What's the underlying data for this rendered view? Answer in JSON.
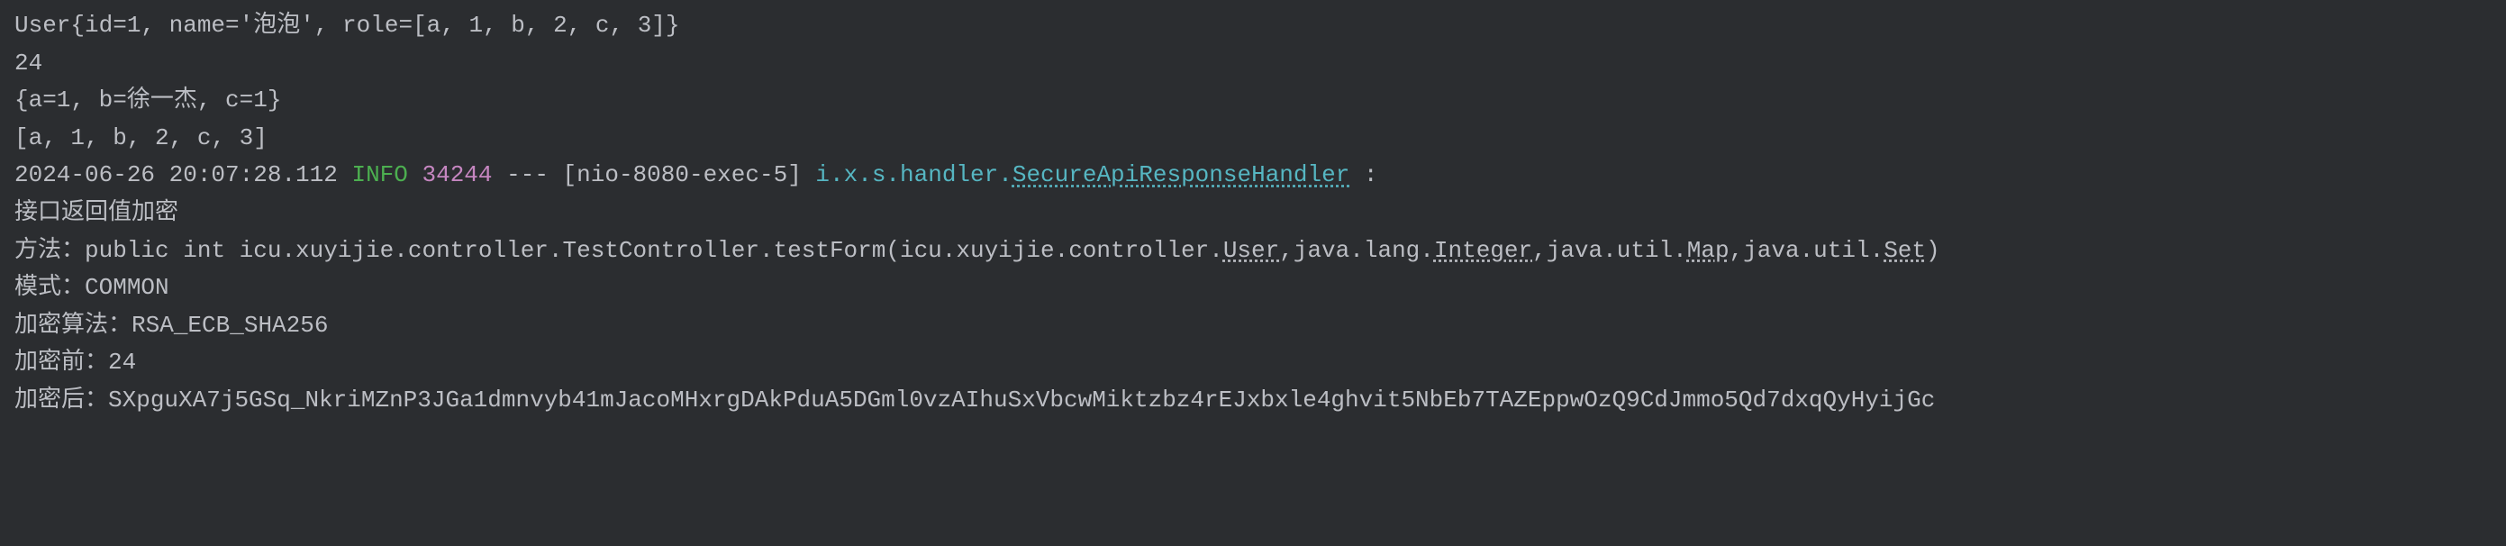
{
  "output": {
    "line1": "User{id=1, name='泡泡', role=[a, 1, b, 2, c, 3]}",
    "line2": "24",
    "line3": "{a=1, b=徐一杰, c=1}",
    "line4": "[a, 1, b, 2, c, 3]"
  },
  "log": {
    "timestamp": "2024-06-26 20:07:28.112",
    "level": "INFO",
    "pid": "34244",
    "separator": "---",
    "thread": "[nio-8080-exec-5]",
    "logger_prefix": "i.x.s.handler.",
    "logger_class": "SecureApiResponseHandler",
    "colon": ":"
  },
  "message": {
    "header": "接口返回值加密",
    "method_label": "方法：",
    "method_prefix": "public int icu.xuyijie.controller.TestController.testForm(icu.xuyijie.controller.",
    "method_user": "User",
    "method_mid1": ",java.lang.",
    "method_integer": "Integer",
    "method_mid2": ",java.util.",
    "method_map": "Map",
    "method_mid3": ",java.util.",
    "method_set": "Set",
    "method_end": ")",
    "mode_label": "模式：",
    "mode_value": "COMMON",
    "algo_label": "加密算法：",
    "algo_value": "RSA_ECB_SHA256",
    "before_label": "加密前：",
    "before_value": "24",
    "after_label": "加密后：",
    "after_value": "SXpguXA7j5GSq_NkriMZnP3JGa1dmnvyb41mJacoMHxrgDAkPduA5DGml0vzAIhuSxVbcwMiktzbz4rEJxbxle4ghvit5NbEb7TAZEppwOzQ9CdJmmo5Qd7dxqQyHyijGc"
  }
}
